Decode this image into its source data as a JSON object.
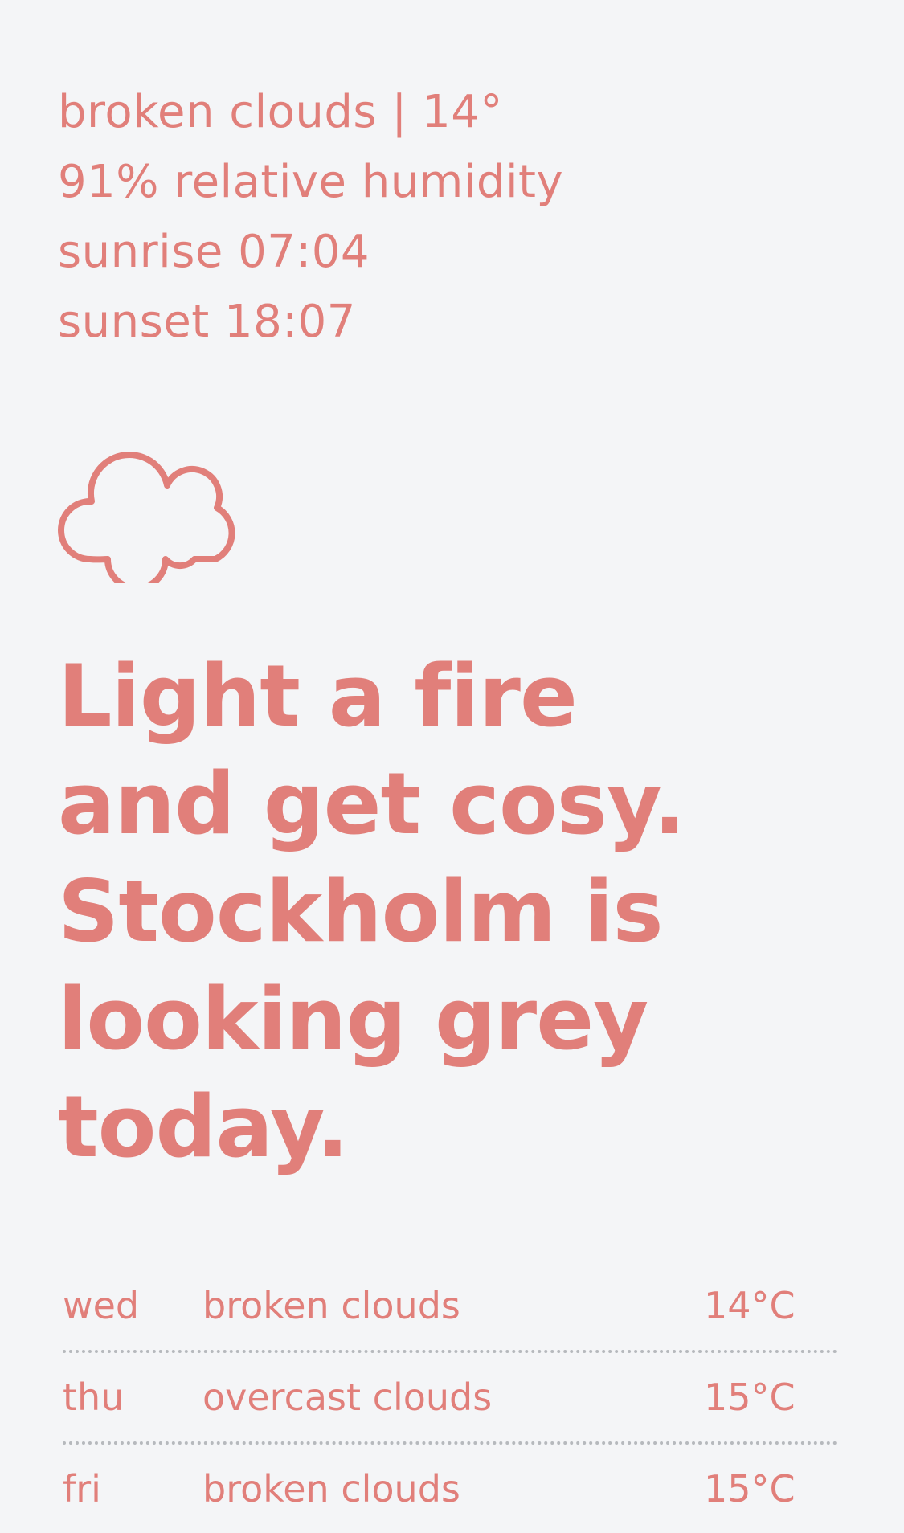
{
  "summary": {
    "condition_line": "broken clouds | 14°",
    "humidity_line": "91% relative humidity",
    "sunrise_line": "sunrise 07:04",
    "sunset_line": "sunset 18:07"
  },
  "weather_icon": "cloud-icon",
  "headline": {
    "line1": "Light a fire",
    "line2": "and get cosy.",
    "line3": "Stockholm is",
    "line4": "looking grey",
    "line5": "today."
  },
  "forecast": [
    {
      "day": "wed",
      "condition": "broken clouds",
      "temp": "14°C"
    },
    {
      "day": "thu",
      "condition": "overcast clouds",
      "temp": "15°C"
    },
    {
      "day": "fri",
      "condition": "broken clouds",
      "temp": "15°C"
    }
  ],
  "colors": {
    "background": "#f4f5f7",
    "accent": "#e17f7a",
    "divider": "#b6b9bd"
  }
}
